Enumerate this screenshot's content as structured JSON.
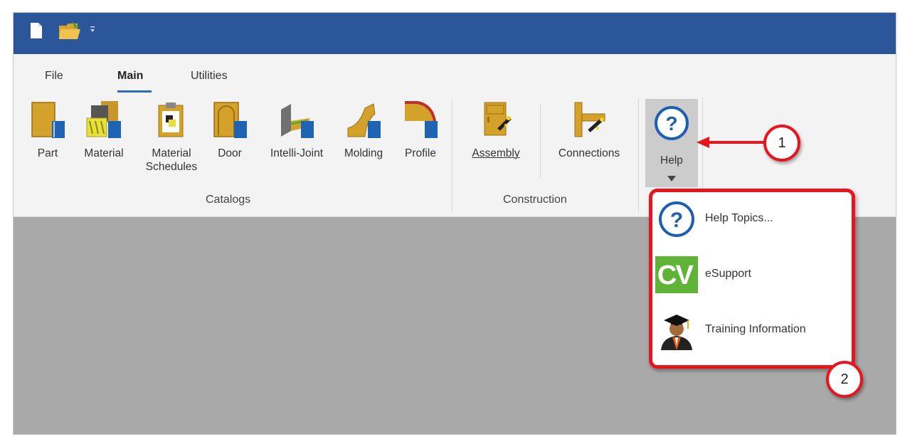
{
  "tabs": [
    {
      "label": "File",
      "active": false
    },
    {
      "label": "Main",
      "active": true
    },
    {
      "label": "Utilities",
      "active": false
    }
  ],
  "ribbon": {
    "catalogs": {
      "group_label": "Catalogs",
      "items": [
        {
          "label": "Part",
          "icon": "part-icon"
        },
        {
          "label": "Material",
          "icon": "material-icon"
        },
        {
          "label": "Material Schedules",
          "icon": "material-schedules-icon"
        },
        {
          "label": "Door",
          "icon": "door-icon"
        },
        {
          "label": "Intelli-Joint",
          "icon": "intelli-joint-icon"
        },
        {
          "label": "Molding",
          "icon": "molding-icon"
        },
        {
          "label": "Profile",
          "icon": "profile-icon"
        }
      ]
    },
    "construction": {
      "group_label": "Construction",
      "items": [
        {
          "label": "Assembly",
          "icon": "assembly-icon"
        },
        {
          "label": "Connections",
          "icon": "connections-icon"
        }
      ]
    },
    "help": {
      "label": "Help",
      "icon": "help-icon"
    }
  },
  "help_menu": {
    "items": [
      {
        "label": "Help Topics...",
        "icon": "help-topics-icon"
      },
      {
        "label": "eSupport",
        "icon": "esupport-cv-icon",
        "icon_text": "CV"
      },
      {
        "label": "Training Information",
        "icon": "graduate-icon"
      }
    ]
  },
  "callouts": {
    "one": "1",
    "two": "2"
  },
  "colors": {
    "titlebar": "#2b579a",
    "accent": "#2b6cc4",
    "callout_red": "#e8141e",
    "icon_gold": "#d4a22a",
    "book_blue": "#1f64b4",
    "esupport_green": "#5fb336"
  }
}
